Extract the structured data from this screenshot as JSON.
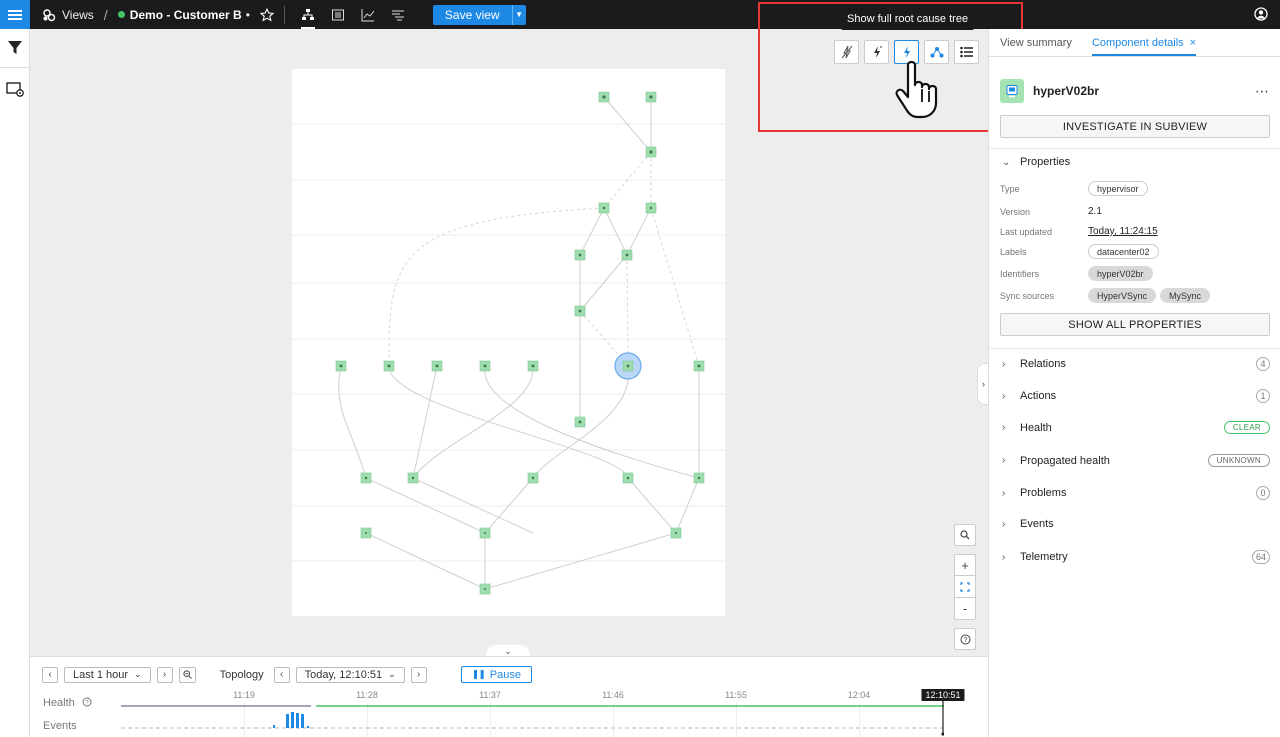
{
  "topbar": {
    "views_label": "Views",
    "view_name": "Demo - Customer B",
    "unsaved_marker": "•",
    "save_label": "Save view",
    "modes": [
      "topology-mode",
      "events-mode",
      "telemetry-mode",
      "list-mode"
    ],
    "active_mode": "topology-mode"
  },
  "leftrail": {
    "icons": [
      "filter-icon",
      "view-settings-icon"
    ]
  },
  "root_cause_toolbar": {
    "tooltip": "Show full root cause tree",
    "buttons": [
      "no-root-cause-icon",
      "probable-root-cause-icon",
      "full-root-cause-icon",
      "topology-layout-icon",
      "list-layout-icon"
    ],
    "active": "full-root-cause-icon"
  },
  "zoom": {
    "search_icon": "search-icon",
    "zoom_in": "+",
    "fit_icon": "fit-to-screen-icon",
    "zoom_out": "-",
    "help_icon": "help-icon"
  },
  "timeline": {
    "range": "Last 1 hour",
    "mode_label": "Topology",
    "time": "Today, 12:10:51",
    "pause_label": "Pause",
    "ticks": [
      "11:19",
      "11:28",
      "11:37",
      "11:46",
      "11:55",
      "12:04"
    ],
    "now_label": "12:10:51",
    "health_label": "Health",
    "events_label": "Events",
    "colors": {
      "health_ok": "#43c467",
      "event_bar": "#1e88e5"
    }
  },
  "rightpanel": {
    "tabs": [
      {
        "label": "View summary"
      },
      {
        "label": "Component details",
        "close": "×"
      }
    ],
    "component_name": "hyperV02br",
    "more": "⋯",
    "investigate_label": "INVESTIGATE IN SUBVIEW",
    "properties_label": "Properties",
    "props": {
      "type_k": "Type",
      "type_v": "hypervisor",
      "version_k": "Version",
      "version_v": "2.1",
      "updated_k": "Last updated",
      "updated_v": "Today, 11:24:15",
      "labels_k": "Labels",
      "labels_v": "datacenter02",
      "ident_k": "Identifiers",
      "ident_v": "hyperV02br",
      "sync_k": "Sync sources",
      "sync_v1": "HyperVSync",
      "sync_v2": "MySync"
    },
    "show_all_label": "SHOW ALL PROPERTIES",
    "sections": {
      "relations": "Relations",
      "relations_count": "4",
      "actions": "Actions",
      "actions_count": "1",
      "health": "Health",
      "health_status": "CLEAR",
      "propagated": "Propagated health",
      "propagated_status": "UNKNOWN",
      "problems": "Problems",
      "problems_count": "0",
      "events": "Events",
      "telemetry": "Telemetry",
      "telemetry_count": "64"
    },
    "colors": {
      "accent": "#1e88e5",
      "clear": "#43c467"
    }
  }
}
